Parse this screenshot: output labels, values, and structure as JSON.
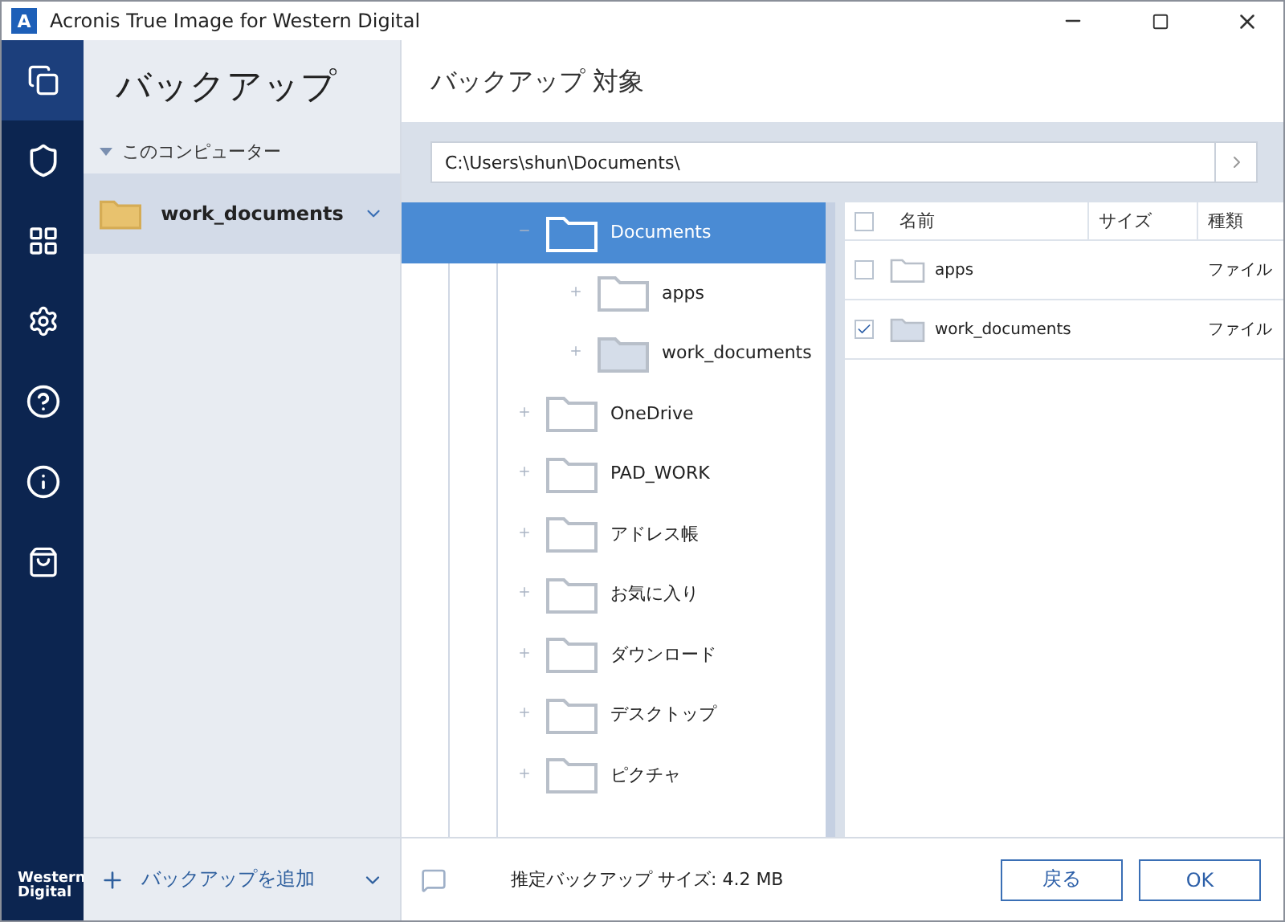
{
  "window": {
    "logo": "A",
    "title": "Acronis True Image for Western Digital"
  },
  "nav": {
    "items": [
      {
        "kind": "backup",
        "selected": true
      },
      {
        "kind": "protect",
        "selected": false
      },
      {
        "kind": "tools",
        "selected": false
      },
      {
        "kind": "settings",
        "selected": false
      },
      {
        "kind": "help",
        "selected": false
      },
      {
        "kind": "info",
        "selected": false
      },
      {
        "kind": "store",
        "selected": false
      }
    ],
    "brand": [
      "Western",
      "Digital"
    ]
  },
  "sidebar": {
    "title": "バックアップ",
    "group": {
      "label": "このコンピューター",
      "expanded": true
    },
    "items": [
      {
        "label": "work_documents",
        "selected": true
      }
    ],
    "add_button": "バックアップを追加"
  },
  "main": {
    "title": "バックアップ 対象",
    "path": "C:\\Users\\shun\\Documents\\",
    "tree": [
      {
        "label": "Documents",
        "selected": true,
        "expanded": true,
        "checked": false,
        "children": [
          {
            "label": "apps",
            "selected": false,
            "expanded": false,
            "checked": false
          },
          {
            "label": "work_documents",
            "selected": false,
            "expanded": false,
            "checked": true
          }
        ]
      },
      {
        "label": "OneDrive",
        "selected": false,
        "expanded": false,
        "checked": false
      },
      {
        "label": "PAD_WORK",
        "selected": false,
        "expanded": false,
        "checked": false
      },
      {
        "label": "アドレス帳",
        "selected": false,
        "expanded": false,
        "checked": false
      },
      {
        "label": "お気に入り",
        "selected": false,
        "expanded": false,
        "checked": false
      },
      {
        "label": "ダウンロード",
        "selected": false,
        "expanded": false,
        "checked": false
      },
      {
        "label": "デスクトップ",
        "selected": false,
        "expanded": false,
        "checked": false
      },
      {
        "label": "ピクチャ",
        "selected": false,
        "expanded": false,
        "checked": false
      }
    ],
    "list": {
      "columns": [
        "名前",
        "サイズ",
        "種類"
      ],
      "all_checked": false,
      "rows": [
        {
          "name": "apps",
          "type": "ファイル",
          "checked": false
        },
        {
          "name": "work_documents",
          "type": "ファイル",
          "checked": true
        }
      ]
    },
    "estimate": "推定バックアップ サイズ: 4.2 MB",
    "buttons": [
      "戻る",
      "OK"
    ]
  }
}
